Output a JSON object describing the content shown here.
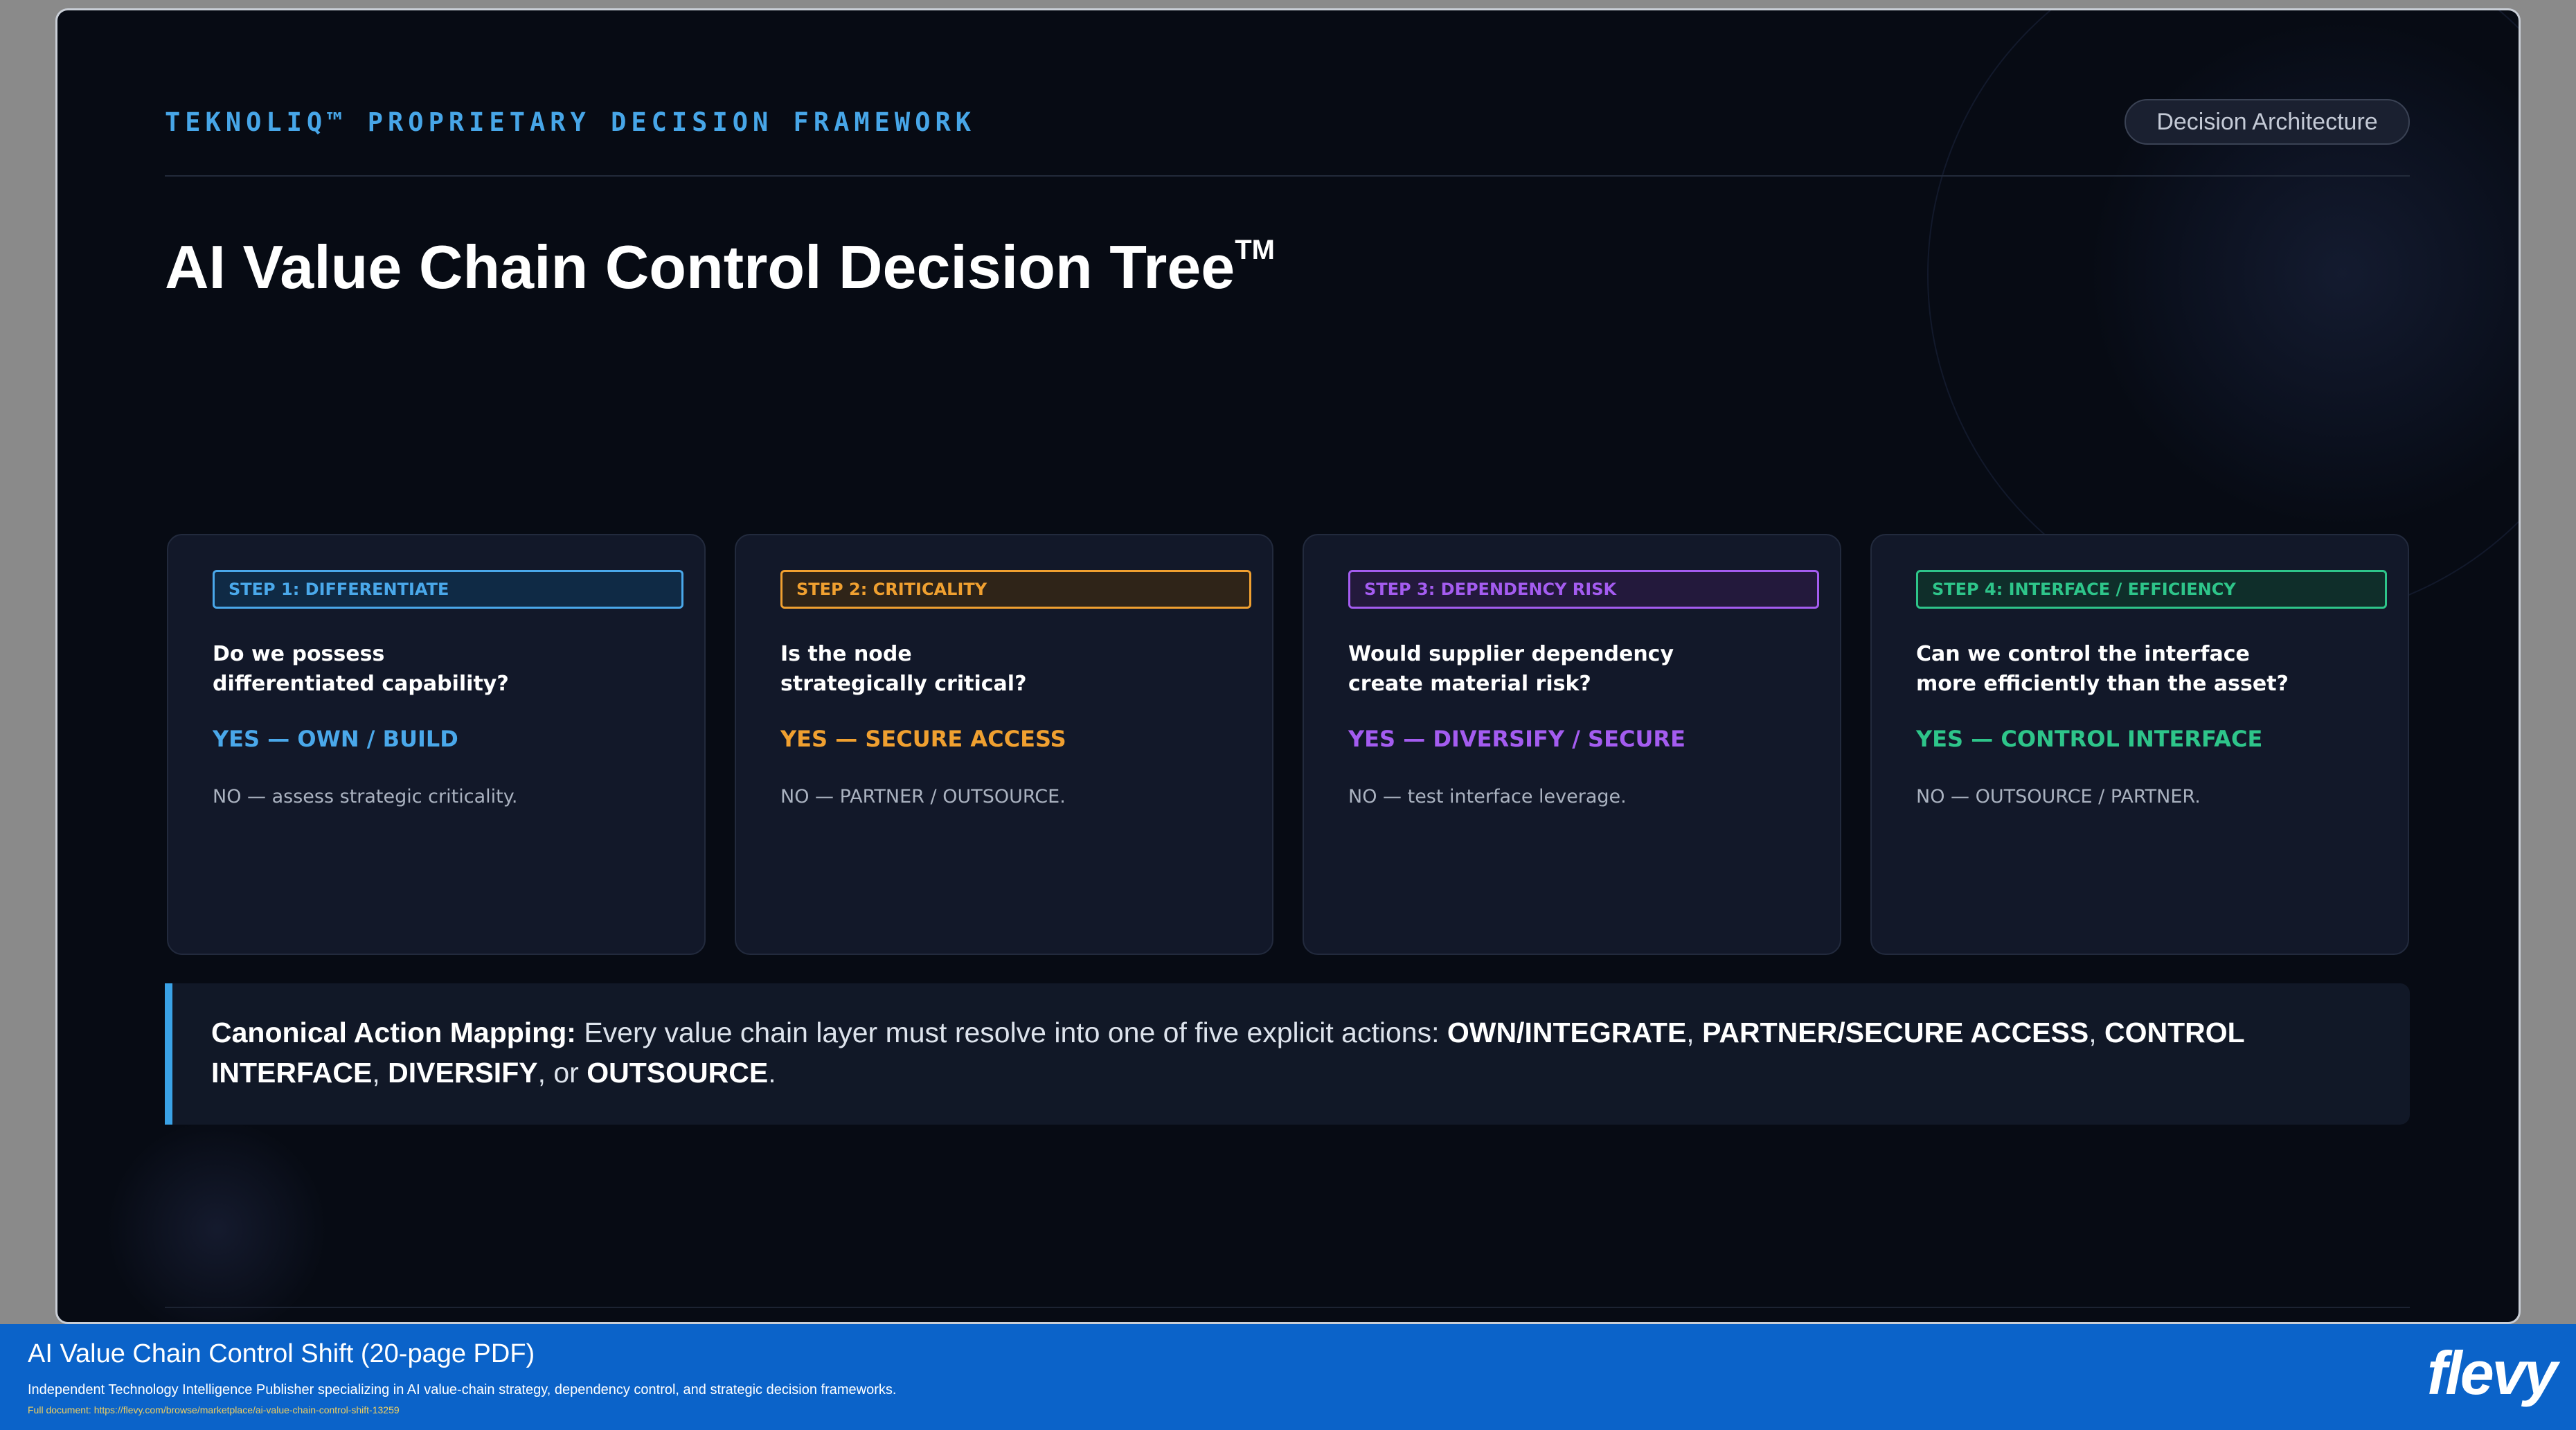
{
  "header": {
    "eyebrow": "TEKNOLIQ™ PROPRIETARY DECISION FRAMEWORK",
    "badge": "Decision Architecture",
    "title": "AI Value Chain Control Decision Tree",
    "title_mark": "TM"
  },
  "steps": [
    {
      "tag": "STEP 1: DIFFERENTIATE",
      "question": "Do we possess\ndifferentiated capability?",
      "yes": "YES — OWN / BUILD",
      "no": "NO — assess strategic criticality.",
      "color": "#4aa8ea",
      "tag_bg": "#0f2a45"
    },
    {
      "tag": "STEP 2: CRITICALITY",
      "question": "Is the node\nstrategically critical?",
      "yes": "YES — SECURE ACCESS",
      "no": "NO — PARTNER / OUTSOURCE.",
      "color": "#f0a030",
      "tag_bg": "#2f2418"
    },
    {
      "tag": "STEP 3: DEPENDENCY RISK",
      "question": "Would supplier dependency\ncreate material risk?",
      "yes": "YES — DIVERSIFY / SECURE",
      "no": "NO — test interface leverage.",
      "color": "#a45cf0",
      "tag_bg": "#23193c"
    },
    {
      "tag": "STEP 4: INTERFACE / EFFICIENCY",
      "question": "Can we control the interface\nmore efficiently than the asset?",
      "yes": "YES — CONTROL INTERFACE",
      "no": "NO — OUTSOURCE / PARTNER.",
      "color": "#2ec58a",
      "tag_bg": "#0f2e2a"
    }
  ],
  "callout": {
    "lead": "Canonical Action Mapping:",
    "text": " Every value chain layer must resolve into one of five explicit actions: ",
    "actions": [
      "OWN/INTEGRATE",
      "PARTNER/SECURE ACCESS",
      "CONTROL INTERFACE",
      "DIVERSIFY",
      "OUTSOURCE"
    ],
    "sep": ", ",
    "or": ", or ",
    "end": "."
  },
  "footer": {
    "title": "AI Value Chain Control Shift",
    "title_suffix": " (20-page PDF)",
    "description": "Independent Technology Intelligence Publisher specializing in AI value-chain strategy, dependency control, and strategic decision frameworks.",
    "link": "Full document: https://flevy.com/browse/marketplace/ai-value-chain-control-shift-13259",
    "logo": "flevy"
  },
  "colors": {
    "accent": "#47a6e8",
    "footer_bg": "#0b63c9",
    "slide_bg": "#070b14"
  }
}
